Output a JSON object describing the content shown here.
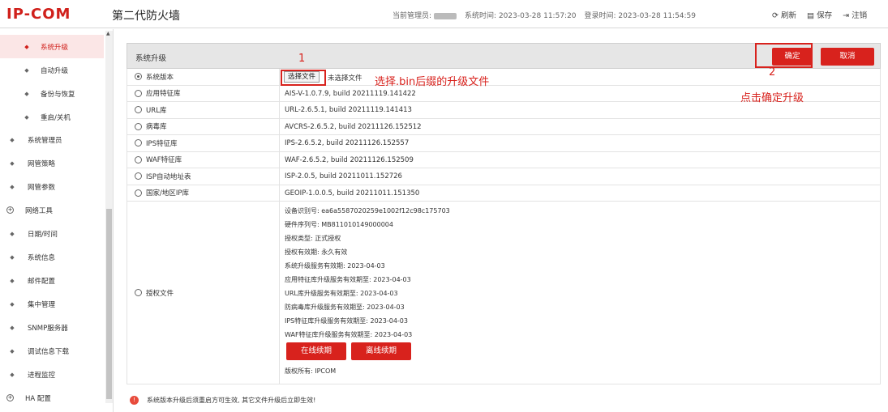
{
  "header": {
    "logo": "IP-COM",
    "title": "第二代防火墙",
    "admin_label": "当前管理员:",
    "system_time": "系统时间: 2023-03-28 11:57:20",
    "login_time": "登录时间: 2023-03-28 11:54:59",
    "refresh": "刷新",
    "save": "保存",
    "logout": "注销"
  },
  "sidebar": {
    "items": [
      {
        "label": "系统升级",
        "level": "sub",
        "active": true
      },
      {
        "label": "自动升级",
        "level": "sub"
      },
      {
        "label": "备份与恢复",
        "level": "sub"
      },
      {
        "label": "重启/关机",
        "level": "sub"
      },
      {
        "label": "系统管理员",
        "level": "top"
      },
      {
        "label": "网管策略",
        "level": "top"
      },
      {
        "label": "网管参数",
        "level": "top"
      },
      {
        "label": "网络工具",
        "level": "top",
        "expand": true
      },
      {
        "label": "日期/时间",
        "level": "top"
      },
      {
        "label": "系统信息",
        "level": "top"
      },
      {
        "label": "邮件配置",
        "level": "top"
      },
      {
        "label": "集中管理",
        "level": "top"
      },
      {
        "label": "SNMP服务器",
        "level": "top"
      },
      {
        "label": "调试信息下载",
        "level": "top"
      },
      {
        "label": "进程监控",
        "level": "top"
      },
      {
        "label": "HA 配置",
        "level": "top",
        "expand": true
      }
    ]
  },
  "panel": {
    "title": "系统升级",
    "confirm": "确定",
    "cancel": "取消",
    "choose_file": "选择文件",
    "no_file": "未选择文件",
    "rows": [
      {
        "label": "系统版本",
        "value": "",
        "selected": true
      },
      {
        "label": "应用特征库",
        "value": "AIS-V-1.0.7.9, build 20211119.141422"
      },
      {
        "label": "URL库",
        "value": "URL-2.6.5.1, build 20211119.141413"
      },
      {
        "label": "病毒库",
        "value": "AVCRS-2.6.5.2, build 20211126.152512"
      },
      {
        "label": "IPS特征库",
        "value": "IPS-2.6.5.2, build 20211126.152557"
      },
      {
        "label": "WAF特征库",
        "value": "WAF-2.6.5.2, build 20211126.152509"
      },
      {
        "label": "ISP自动地址表",
        "value": "ISP-2.0.5, build 20211011.152726"
      },
      {
        "label": "国家/地区IP库",
        "value": "GEOIP-1.0.0.5, build 20211011.151350"
      }
    ],
    "license": {
      "label": "授权文件",
      "lines": [
        "设备识别号: ea6a5587020259e1002f12c98c175703",
        "硬件序列号: MB811010149000004",
        "授权类型: 正式授权",
        "授权有效期: 永久有效",
        "系统升级服务有效期: 2023-04-03",
        "应用特征库升级服务有效期至: 2023-04-03",
        "URL库升级服务有效期至: 2023-04-03",
        "防病毒库升级服务有效期至: 2023-04-03",
        "IPS特征库升级服务有效期至: 2023-04-03",
        "WAF特征库升级服务有效期至: 2023-04-03"
      ],
      "online_renew": "在线续期",
      "offline_renew": "离线续期",
      "copyright": "版权所有: IPCOM"
    },
    "notice": "系统版本升级后须重启方可生效, 其它文件升级后立即生效!"
  },
  "annotations": {
    "step1": "1",
    "step1_text": "选择.bin后缀的升级文件",
    "step2": "2",
    "step2_text": "点击确定升级"
  },
  "colors": {
    "brand": "#d0201b",
    "button": "#d8221d"
  }
}
